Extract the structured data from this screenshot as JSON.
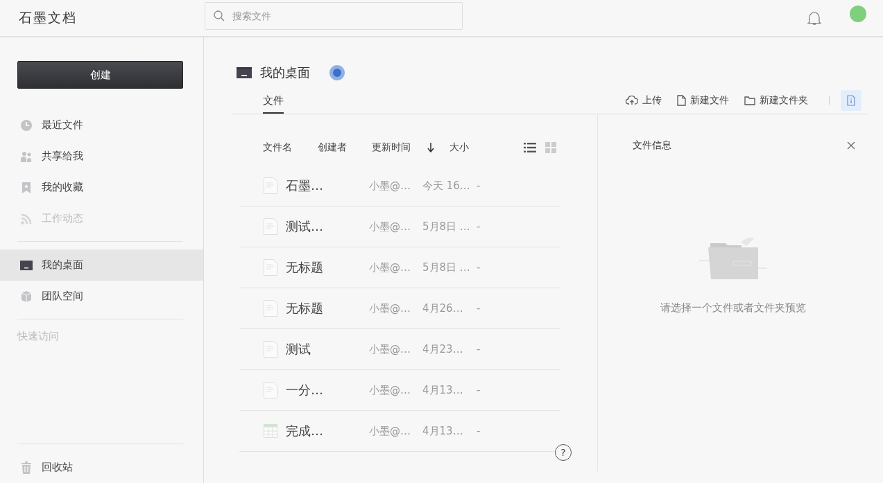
{
  "header": {
    "logo": "石墨文档",
    "search": {
      "placeholder": "搜索文件"
    }
  },
  "sidebar": {
    "create_button": "创建",
    "groups": [
      [
        {
          "label": "最近文件",
          "selected": false,
          "disabled": false
        },
        {
          "label": "共享给我",
          "selected": false,
          "disabled": false
        },
        {
          "label": "我的收藏",
          "selected": false,
          "disabled": false
        },
        {
          "label": "工作动态",
          "selected": false,
          "disabled": true
        }
      ],
      [
        {
          "label": "我的桌面",
          "selected": true,
          "disabled": false
        },
        {
          "label": "团队空间",
          "selected": false,
          "disabled": false
        }
      ]
    ],
    "quick_access_label": "快速访问",
    "trash": {
      "label": "回收站",
      "selected": false,
      "disabled": false
    }
  },
  "main": {
    "title": "我的桌面",
    "tabs": [
      {
        "label": "文件",
        "selected": true
      }
    ],
    "toolbar": [
      {
        "label": "上传"
      },
      {
        "label": "新建文件"
      },
      {
        "label": "新建文件夹"
      }
    ],
    "info_button": {
      "selected": true
    },
    "columns": [
      "文件名",
      "创建者",
      "更新时间",
      "大小"
    ],
    "view_modes": [
      {
        "selected": true
      },
      {
        "selected": false
      }
    ],
    "rows": [
      {
        "kind": "doc",
        "name": "石墨…",
        "creator": "小墨@…",
        "updated": "今天 16…",
        "size": "-"
      },
      {
        "kind": "doc",
        "name": "测试…",
        "creator": "小墨@…",
        "updated": "5月8日 …",
        "size": "-"
      },
      {
        "kind": "doc",
        "name": "无标题",
        "creator": "小墨@…",
        "updated": "5月8日 …",
        "size": "-"
      },
      {
        "kind": "doc",
        "name": "无标题",
        "creator": "小墨@…",
        "updated": "4月26…",
        "size": "-"
      },
      {
        "kind": "doc",
        "name": "测试",
        "creator": "小墨@…",
        "updated": "4月23…",
        "size": "-"
      },
      {
        "kind": "doc",
        "name": "一分…",
        "creator": "小墨@…",
        "updated": "4月13…",
        "size": "-"
      },
      {
        "kind": "sheet",
        "name": "完成…",
        "creator": "小墨@…",
        "updated": "4月13…",
        "size": "-"
      }
    ],
    "help_button": "?",
    "info_panel": {
      "title": "文件信息",
      "empty_message": "请选择一个文件或者文件夹预览"
    }
  }
}
